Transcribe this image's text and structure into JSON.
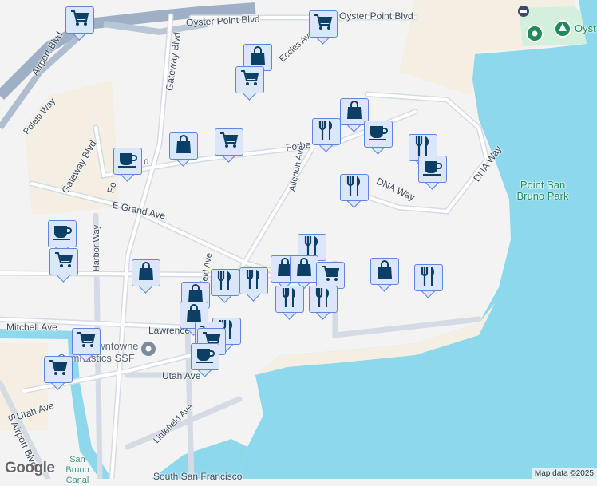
{
  "colors": {
    "water": "#8ed8ec",
    "land": "#f4f3f4",
    "sand": "#f4efe2",
    "park": "#d3f0dc",
    "marker_bg": "#dce6fb",
    "marker_border": "#5f85e3",
    "icon": "#0b3f66"
  },
  "labels": {
    "oyster_point_blvd_1": "Oyster Point Blvd",
    "oyster_point_blvd_2": "Oyster Point Blvd",
    "eccles_ave": "Eccles Ave",
    "gateway_blvd_1": "Gateway Blvd",
    "gateway_blvd_2": "Gateway Blvd",
    "airport_blvd": "Airport Blvd",
    "poletti_way": "Poletti Way",
    "forbes_blvd_1": "Forbe",
    "forbes_blvd_2": "Fo",
    "forbes_blvd_3": "d",
    "e_grand_ave": "E Grand Ave.",
    "harbor_way": "Harbor Way",
    "allerton_ave": "Allerton Ave",
    "dna_way_1": "DNA Way",
    "dna_way_2": "DNA Way",
    "littlefield_ave_1": "ield Ave",
    "littlefield_ave_2": "Littlefield Ave",
    "mitchell_ave": "Mitchell Ave",
    "lawrence": "Lawrence",
    "gym_1": "owntowne",
    "gym_2": "Gymnastics SSF",
    "utah_ave_1": "Utah Ave",
    "utah_ave_2": "Utah Ave",
    "s_airport_blvd": "S Airport Blvd",
    "point_san_bruno_park": "Point San Bruno Park",
    "oyster": "Oyst",
    "san_bruno_canal": "San Bruno Canal",
    "south_ferry": "South San Francisco"
  },
  "markers": [
    {
      "type": "cart"
    },
    {
      "type": "cart"
    },
    {
      "type": "bag"
    },
    {
      "type": "cart"
    },
    {
      "type": "bag"
    },
    {
      "type": "fork"
    },
    {
      "type": "cup"
    },
    {
      "type": "fork"
    },
    {
      "type": "cup"
    },
    {
      "type": "bag"
    },
    {
      "type": "cart"
    },
    {
      "type": "cup"
    },
    {
      "type": "fork"
    },
    {
      "type": "cup"
    },
    {
      "type": "cart"
    },
    {
      "type": "bag"
    },
    {
      "type": "fork"
    },
    {
      "type": "bag"
    },
    {
      "type": "bag"
    },
    {
      "type": "cart"
    },
    {
      "type": "bag"
    },
    {
      "type": "fork"
    },
    {
      "type": "fork"
    },
    {
      "type": "fork"
    },
    {
      "type": "bag"
    },
    {
      "type": "fork"
    },
    {
      "type": "fork"
    },
    {
      "type": "bag"
    },
    {
      "type": "fork"
    },
    {
      "type": "cart"
    },
    {
      "type": "cart"
    },
    {
      "type": "cup"
    },
    {
      "type": "cart"
    },
    {
      "type": "cart"
    }
  ],
  "attribution": "Map data ©2025",
  "logo": "Google"
}
